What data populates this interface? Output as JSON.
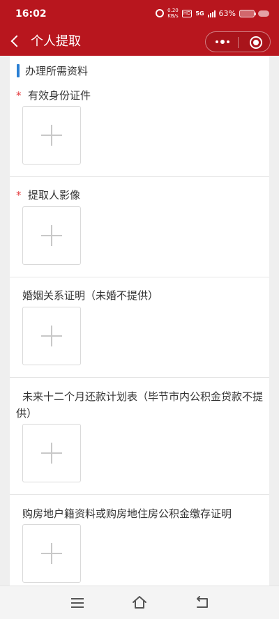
{
  "status_bar": {
    "time": "16:02",
    "net_speed_value": "0.20",
    "net_speed_unit": "KB/s",
    "hd_label": "HD",
    "network_label": "5G",
    "battery_percent": "63%"
  },
  "header": {
    "title": "个人提取"
  },
  "section": {
    "title": "办理所需资料"
  },
  "fields": [
    {
      "required": true,
      "required_mark": "*",
      "label": "有效身份证件"
    },
    {
      "required": true,
      "required_mark": "*",
      "label": "提取人影像"
    },
    {
      "required": false,
      "label": "婚姻关系证明（未婚不提供）"
    },
    {
      "required": false,
      "label": "未来十二个月还款计划表（毕节市内公积金贷款不提供）"
    },
    {
      "required": false,
      "label": "购房地户籍资料或购房地住房公积金缴存证明"
    }
  ],
  "colors": {
    "header_bg": "#b8161e",
    "section_accent": "#2a7fd4",
    "required_mark": "#e4393c"
  }
}
